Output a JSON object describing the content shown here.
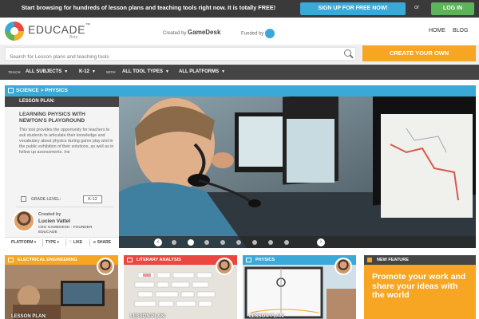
{
  "topbar": {
    "message": "Start browsing for hundreds of lesson plans and teaching tools right now. It is totally FREE!",
    "signup_label": "SIGN UP FOR FREE NOW!",
    "or_label": "or",
    "login_label": "LOG IN"
  },
  "header": {
    "logo_text": "EDUCADE",
    "logo_tm": "™",
    "logo_beta": "Beta",
    "created_by_label": "Created by",
    "created_by_name": "GameDesk",
    "funded_by_label": "Funded by",
    "nav": [
      "HOME",
      "BLOG"
    ]
  },
  "search": {
    "placeholder": "Search for Lesson plans and teaching tools",
    "create_label": "CREATE YOUR OWN"
  },
  "filters": {
    "teach_label": "TEACH",
    "subjects": "ALL SUBJECTS",
    "grade": "K-12",
    "with_label": "WITH",
    "tool_types": "ALL TOOL TYPES",
    "platforms": "ALL PLATFORMS"
  },
  "featured": {
    "breadcrumb": "SCIENCE > PHYSICS",
    "lesson_label": "LESSON PLAN:",
    "title": "LEARNING PHYSICS WITH NEWTON'S PLAYGROUND",
    "description": "This tool provides the opportunity for teachers to ask students to articulate their knowledge and vocabulary about physics during game play and in the public exhibition of their solutions, as well as in follow up assessments. Ine",
    "grade_level_label": "GRADE LEVEL:",
    "grade_level_value": "K-12",
    "created_by_label": "Created by",
    "author_name": "Lucien Vattel",
    "author_role": "CEO GAMEDESK - FOUNDER EDUCADE",
    "platform_label": "PLATFORM",
    "type_label": "TYPE",
    "like_label": "LIKE",
    "share_label": "SHARE"
  },
  "carousel": {
    "dot_count": 8,
    "active_index": 1
  },
  "cards": [
    {
      "category": "ELECTRICAL ENGINEERING",
      "color": "#f6a623",
      "footer": "LESSON PLAN:"
    },
    {
      "category": "LITERARY ANALYSIS",
      "color": "#e9473f",
      "footer": "LESSON PLAN:"
    },
    {
      "category": "PHYSICS",
      "color": "#3aa9d8",
      "footer": "LESSON PLAN:"
    }
  ],
  "promo": {
    "header": "NEW FEATURE",
    "text": "Promote your work and share your ideas with the world"
  },
  "colors": {
    "brand_blue": "#3aa9d8",
    "brand_orange": "#f6a623",
    "brand_green": "#5db35a",
    "brand_red": "#e9473f",
    "dark_bar": "#444444"
  }
}
